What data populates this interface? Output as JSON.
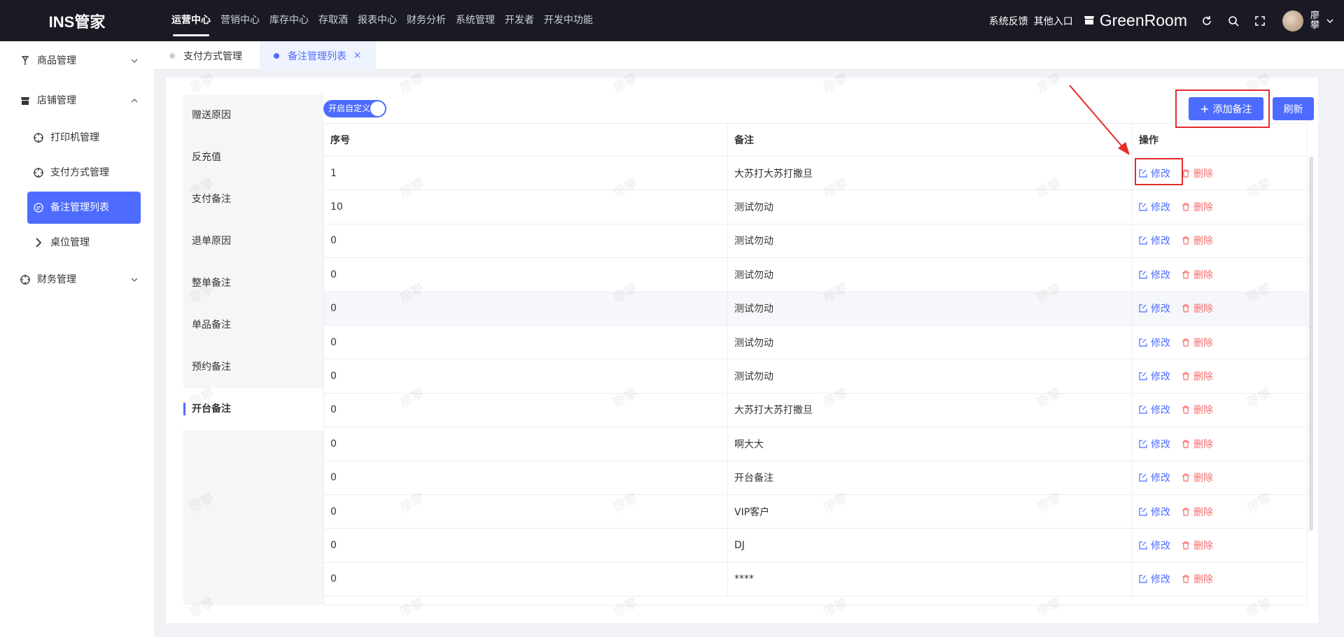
{
  "app": {
    "logo": "INS管家"
  },
  "top_nav": [
    {
      "label": "运营中心",
      "active": true
    },
    {
      "label": "营销中心"
    },
    {
      "label": "库存中心"
    },
    {
      "label": "存取酒"
    },
    {
      "label": "报表中心"
    },
    {
      "label": "财务分析"
    },
    {
      "label": "系统管理"
    },
    {
      "label": "开发者"
    },
    {
      "label": "开发中功能"
    }
  ],
  "top_right": {
    "feedback": "系统反馈",
    "other_entry": "其他入口",
    "store_name": "GreenRoom",
    "username": "廖攀"
  },
  "sidebar": {
    "groups": [
      {
        "label": "商品管理",
        "icon": "product-icon",
        "expanded": false
      },
      {
        "label": "店铺管理",
        "icon": "store-icon",
        "expanded": true
      },
      {
        "label": "财务管理",
        "icon": "finance-icon",
        "expanded": false
      }
    ],
    "sub_items": [
      {
        "label": "打印机管理",
        "icon": "target-icon"
      },
      {
        "label": "支付方式管理",
        "icon": "target-icon"
      },
      {
        "label": "备注管理列表",
        "icon": "comment-icon",
        "active": true
      },
      {
        "label": "桌位管理",
        "icon": "chevron-right-icon"
      }
    ]
  },
  "tabs": [
    {
      "label": "支付方式管理",
      "active": false
    },
    {
      "label": "备注管理列表",
      "active": true,
      "close": "×"
    }
  ],
  "categories": [
    {
      "label": "赠送原因"
    },
    {
      "label": "反充值"
    },
    {
      "label": "支付备注"
    },
    {
      "label": "退单原因"
    },
    {
      "label": "整单备注"
    },
    {
      "label": "单品备注"
    },
    {
      "label": "预约备注"
    },
    {
      "label": "开台备注",
      "active": true
    }
  ],
  "toggle": {
    "label": "开启自定义",
    "on": true
  },
  "buttons": {
    "add": "添加备注",
    "refresh": "刷新"
  },
  "table": {
    "headers": [
      "序号",
      "备注",
      "操作"
    ],
    "edit_label": "修改",
    "delete_label": "删除",
    "rows": [
      {
        "seq": "1",
        "note": "大苏打大苏打撒旦"
      },
      {
        "seq": "10",
        "note": "测试勿动"
      },
      {
        "seq": "0",
        "note": "测试勿动"
      },
      {
        "seq": "0",
        "note": "测试勿动"
      },
      {
        "seq": "0",
        "note": "测试勿动"
      },
      {
        "seq": "0",
        "note": "测试勿动"
      },
      {
        "seq": "0",
        "note": "测试勿动"
      },
      {
        "seq": "0",
        "note": "大苏打大苏打撒旦"
      },
      {
        "seq": "0",
        "note": "啊大大"
      },
      {
        "seq": "0",
        "note": "开台备注"
      },
      {
        "seq": "0",
        "note": "VIP客户"
      },
      {
        "seq": "0",
        "note": "DJ"
      },
      {
        "seq": "0",
        "note": "****"
      }
    ]
  },
  "watermark": "廖攀",
  "colors": {
    "primary": "#4d6cff",
    "danger": "#f56c6c",
    "topbar": "#191a24",
    "annotation": "#e62b2b"
  }
}
